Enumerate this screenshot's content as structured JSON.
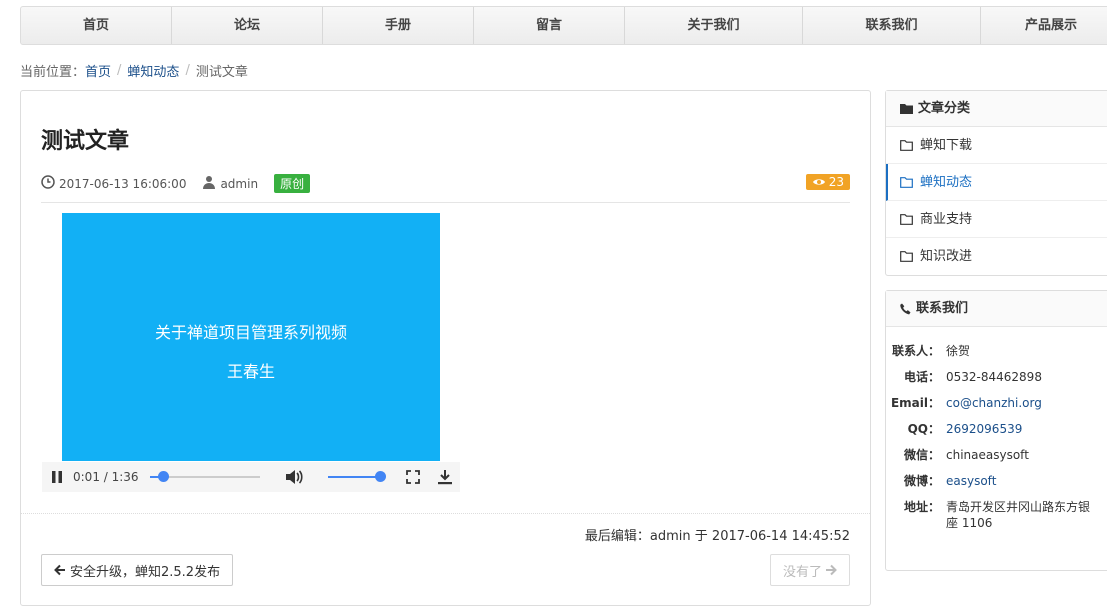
{
  "nav": {
    "items": [
      {
        "label": "首页",
        "width": 151
      },
      {
        "label": "论坛",
        "width": 151
      },
      {
        "label": "手册",
        "width": 151
      },
      {
        "label": "留言",
        "width": 151
      },
      {
        "label": "关于我们",
        "width": 178
      },
      {
        "label": "联系我们",
        "width": 178
      },
      {
        "label": "产品展示",
        "width": 140
      }
    ]
  },
  "breadcrumb": {
    "prefix": "当前位置：",
    "items": [
      "首页",
      "蝉知动态"
    ],
    "current": "测试文章"
  },
  "article": {
    "title": "测试文章",
    "date": "2017-06-13 16:06:00",
    "author": "admin",
    "badge": "原创",
    "views": "23",
    "video": {
      "line1": "关于禅道项目管理系列视频",
      "line2": "王春生",
      "time": "0:01 / 1:36",
      "progress": 0.12,
      "volume": 1.0
    },
    "edited": "最后编辑：admin 于 2017-06-14 14:45:52",
    "prev_label": "安全升级，蝉知2.5.2发布",
    "next_label": "没有了"
  },
  "sidebar": {
    "categories": {
      "title": "文章分类",
      "items": [
        "蝉知下载",
        "蝉知动态",
        "商业支持",
        "知识改进"
      ],
      "active_index": 1
    },
    "contact": {
      "title": "联系我们",
      "rows": [
        {
          "label": "联系人：",
          "value": "徐贺"
        },
        {
          "label": "电话：",
          "value": "0532-84462898"
        },
        {
          "label": "Email：",
          "value": "co@chanzhi.org"
        },
        {
          "label": "QQ：",
          "value": "2692096539"
        },
        {
          "label": "微信：",
          "value": "chinaeasysoft"
        },
        {
          "label": "微博：",
          "value": "easysoft"
        },
        {
          "label": "地址：",
          "value": "青岛开发区井冈山路东方银座 1106"
        }
      ]
    }
  },
  "colors": {
    "accent": "#1b6fc2",
    "video_bg": "#12b0f5",
    "badge_green": "#38b03f",
    "badge_orange": "#f1a325"
  }
}
